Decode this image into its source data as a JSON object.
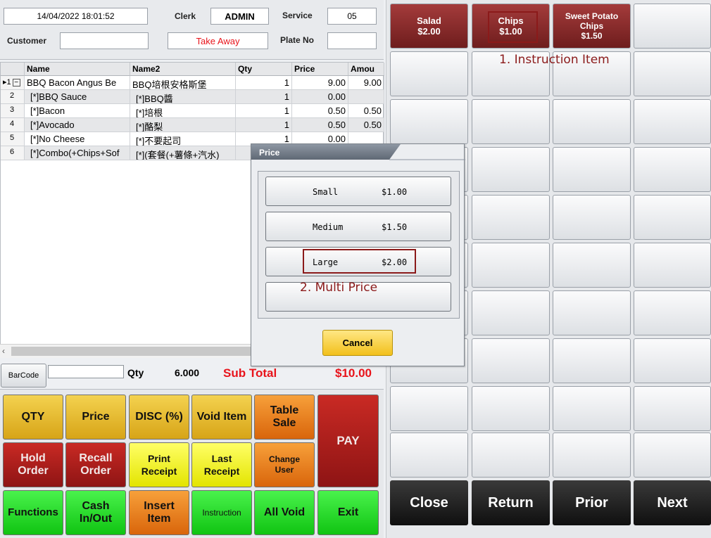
{
  "header": {
    "datetime": "14/04/2022 18:01:52",
    "clerk_label": "Clerk",
    "clerk_value": "ADMIN",
    "service_label": "Service",
    "service_value": "05",
    "customer_label": "Customer",
    "customer_value": "",
    "order_type": "Take Away",
    "plate_label": "Plate No",
    "plate_value": ""
  },
  "grid": {
    "columns": [
      "Name",
      "Name2",
      "Qty",
      "Price",
      "Amou"
    ],
    "rows": [
      {
        "no": "1",
        "name": "BBQ Bacon Angus Be",
        "name2": "BBQ培根安格斯堡",
        "qty": "1",
        "price": "9.00",
        "amount": "9.00"
      },
      {
        "no": "2",
        "name": "[*]BBQ Sauce",
        "name2": "[*]BBQ醬",
        "qty": "1",
        "price": "0.00",
        "amount": ""
      },
      {
        "no": "3",
        "name": "[*]Bacon",
        "name2": "[*]培根",
        "qty": "1",
        "price": "0.50",
        "amount": "0.50"
      },
      {
        "no": "4",
        "name": "[*]Avocado",
        "name2": "[*]酪梨",
        "qty": "1",
        "price": "0.50",
        "amount": "0.50"
      },
      {
        "no": "5",
        "name": "[*]No Cheese",
        "name2": "[*]不要起司",
        "qty": "1",
        "price": "0.00",
        "amount": ""
      },
      {
        "no": "6",
        "name": "[*]Combo(+Chips+Sof",
        "name2": "[*](套餐(+薯條+汽水)",
        "qty": "",
        "price": "",
        "amount": ""
      }
    ]
  },
  "summary": {
    "barcode_label": "BarCode",
    "qty_label": "Qty",
    "qty_value": "6.000",
    "subtotal_label": "Sub Total",
    "subtotal_value": "$10.00"
  },
  "actions": {
    "qty": "QTY",
    "price": "Price",
    "disc": "DISC (%)",
    "void_item": "Void Item",
    "table_sale": "Table\nSale",
    "pay": "PAY",
    "hold_order": "Hold\nOrder",
    "recall_order": "Recall\nOrder",
    "print_receipt": "Print\nReceipt",
    "last_receipt": "Last\nReceipt",
    "change_user": "Change\nUser",
    "functions": "Functions",
    "cash_in_out": "Cash\nIn/Out",
    "insert_item": "Insert\nItem",
    "instruction": "Instruction",
    "all_void": "All Void",
    "exit": "Exit"
  },
  "items": {
    "salad": "Salad\n$2.00",
    "chips": "Chips\n$1.00",
    "sweet_potato": "Sweet Potato\nChips\n$1.50"
  },
  "nav": {
    "close": "Close",
    "return": "Return",
    "prior": "Prior",
    "next": "Next"
  },
  "dialog": {
    "title": "Price",
    "options": [
      {
        "name": "Small",
        "price": "$1.00"
      },
      {
        "name": "Medium",
        "price": "$1.50"
      },
      {
        "name": "Large",
        "price": "$2.00"
      }
    ],
    "cancel": "Cancel"
  },
  "annotations": {
    "instruction_item": "1. Instruction Item",
    "multi_price": "2. Multi Price"
  },
  "colors": {
    "accent_red": "#e8141b",
    "annotation": "#8b1a1a",
    "item_tile": "#8b2a2a"
  }
}
